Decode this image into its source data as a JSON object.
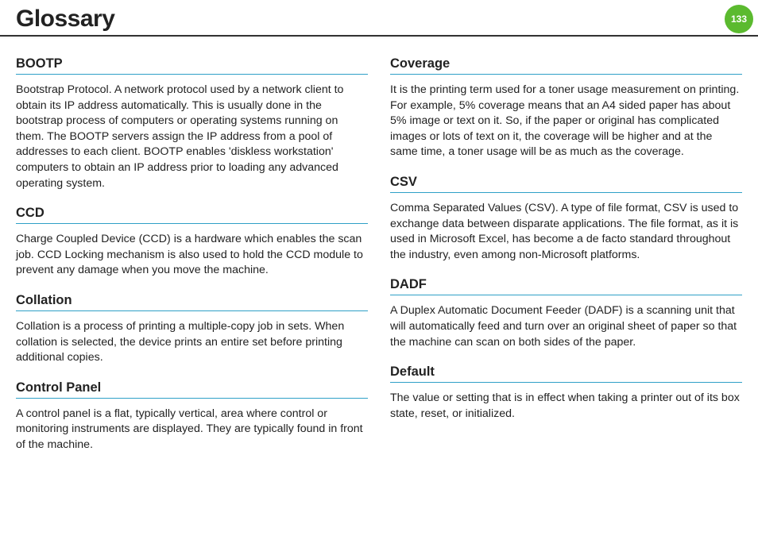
{
  "page": {
    "title": "Glossary",
    "number": "133"
  },
  "left": [
    {
      "term": "BOOTP",
      "def": "Bootstrap Protocol. A network protocol used by a network client to obtain its IP address automatically. This is usually done in the bootstrap process of computers or operating systems running on them. The BOOTP servers assign the IP address from a pool of addresses to each client. BOOTP enables 'diskless workstation' computers to obtain an IP address prior to loading any advanced operating system."
    },
    {
      "term": "CCD",
      "def": "Charge Coupled Device (CCD) is a hardware which enables the scan job. CCD Locking mechanism is also used to hold the CCD module to prevent any damage when you move the machine."
    },
    {
      "term": "Collation",
      "def": "Collation is a process of printing a multiple-copy job in sets. When collation is selected, the device prints an entire set before printing additional copies."
    },
    {
      "term": "Control Panel",
      "def": "A control panel is a flat, typically vertical, area where control or monitoring instruments are displayed. They are typically found in front of the machine."
    }
  ],
  "right": [
    {
      "term": "Coverage",
      "def": "It is the printing term used for a toner usage measurement on printing. For example, 5% coverage means that an A4 sided paper has about 5% image or text on it. So, if the paper or original has complicated images or lots of text on it, the coverage will be higher and at the same time, a toner usage will be as much as the coverage."
    },
    {
      "term": "CSV",
      "def": "Comma Separated Values (CSV). A type of file format, CSV is used to exchange data between disparate applications. The file format, as it is used in Microsoft Excel, has become a de facto standard throughout the industry, even among non-Microsoft platforms."
    },
    {
      "term": "DADF",
      "def": "A Duplex Automatic Document Feeder (DADF) is a scanning unit that will automatically feed and turn over an original sheet of paper so that the machine can scan on both sides of the paper."
    },
    {
      "term": "Default",
      "def": "The value or setting that is in effect when taking a printer out of its box state, reset, or initialized."
    }
  ]
}
